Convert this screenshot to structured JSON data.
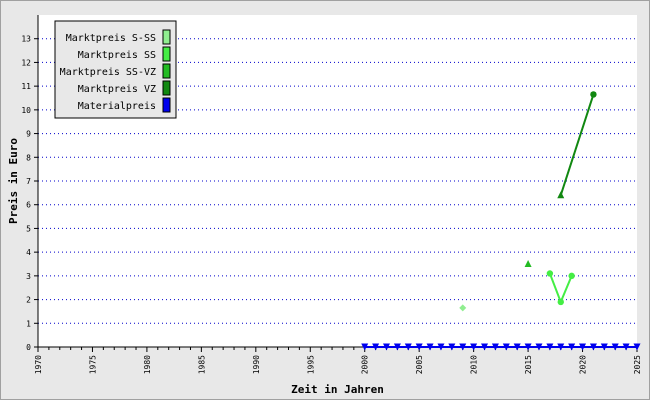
{
  "chart_data": {
    "type": "line",
    "xlabel": "Zeit in Jahren",
    "ylabel": "Preis in Euro",
    "xlim": [
      1970,
      2025
    ],
    "ylim": [
      0,
      14
    ],
    "x_ticks": [
      1970,
      1975,
      1980,
      1985,
      1990,
      1995,
      2000,
      2005,
      2010,
      2015,
      2020,
      2025
    ],
    "y_ticks": [
      0,
      1,
      2,
      3,
      4,
      5,
      6,
      7,
      8,
      9,
      10,
      11,
      12,
      13
    ],
    "grid": "horizontal-dotted",
    "legend_position": "top-left",
    "series": [
      {
        "name": "Marktpreis S-SS",
        "color": "#90ee90",
        "marker": "diamond",
        "connect": true,
        "points": [
          [
            2009,
            1.65
          ]
        ]
      },
      {
        "name": "Marktpreis SS",
        "color": "#44ee44",
        "marker": "circle",
        "connect": true,
        "points": [
          [
            2017,
            3.1
          ],
          [
            2018,
            1.9
          ],
          [
            2019,
            3.0
          ]
        ]
      },
      {
        "name": "Marktpreis SS-VZ",
        "color": "#22bb22",
        "marker": "triangle",
        "connect": true,
        "points": [
          [
            2015,
            3.5
          ]
        ]
      },
      {
        "name": "Marktpreis VZ",
        "color": "#118811",
        "marker": "mixed",
        "connect": true,
        "points": [
          [
            2018,
            6.4
          ],
          [
            2021,
            10.65
          ]
        ]
      },
      {
        "name": "Materialpreis",
        "color": "#0000ee",
        "marker": "triangle-down",
        "connect": true,
        "points": [
          [
            2000,
            0
          ],
          [
            2001,
            0
          ],
          [
            2002,
            0
          ],
          [
            2003,
            0
          ],
          [
            2004,
            0
          ],
          [
            2005,
            0
          ],
          [
            2006,
            0
          ],
          [
            2007,
            0
          ],
          [
            2008,
            0
          ],
          [
            2009,
            0
          ],
          [
            2010,
            0
          ],
          [
            2011,
            0
          ],
          [
            2012,
            0
          ],
          [
            2013,
            0
          ],
          [
            2014,
            0
          ],
          [
            2015,
            0
          ],
          [
            2016,
            0
          ],
          [
            2017,
            0
          ],
          [
            2018,
            0
          ],
          [
            2019,
            0
          ],
          [
            2020,
            0
          ],
          [
            2021,
            0
          ],
          [
            2022,
            0
          ],
          [
            2023,
            0
          ],
          [
            2024,
            0
          ],
          [
            2025,
            0
          ]
        ]
      }
    ]
  }
}
